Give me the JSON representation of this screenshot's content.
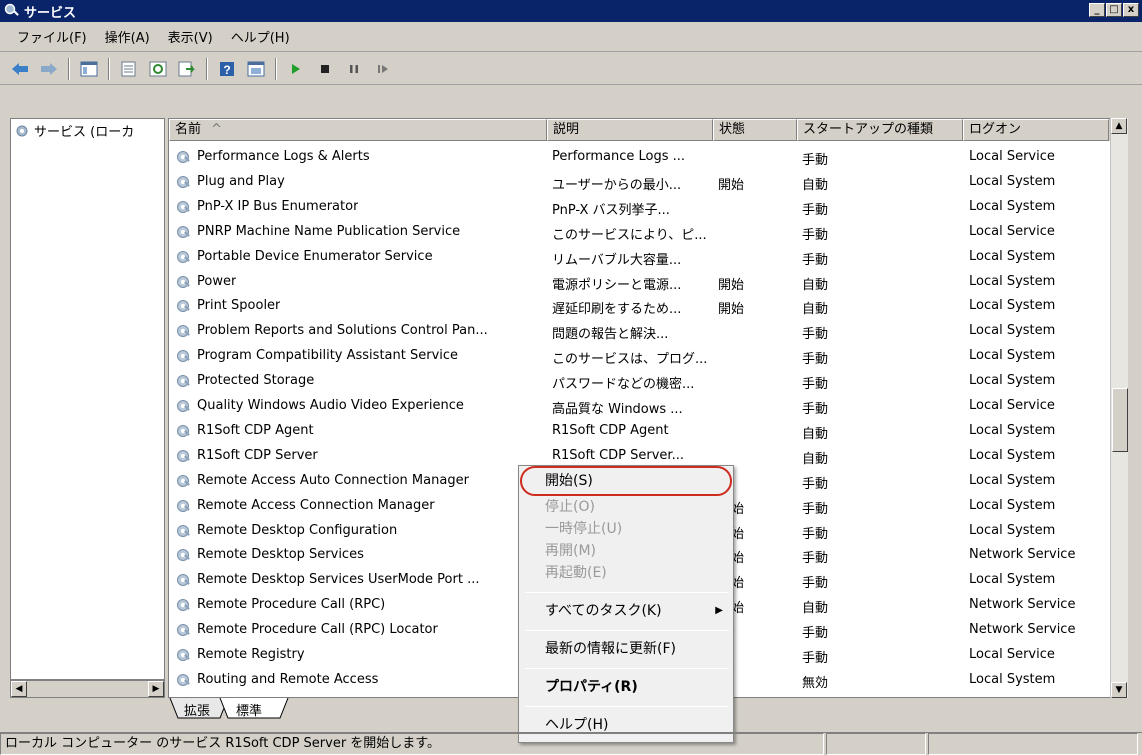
{
  "window": {
    "title": "サービス"
  },
  "menubar": [
    "ファイル(F)",
    "操作(A)",
    "表示(V)",
    "ヘルプ(H)"
  ],
  "toolbar": [
    "back-icon",
    "forward-icon",
    "up-icon",
    "show-hide-tree-icon",
    "properties-icon",
    "refresh-icon",
    "export-icon",
    "help-icon",
    "list-view-icon",
    "start-icon",
    "stop-icon",
    "pause-icon",
    "resume-icon"
  ],
  "tree": {
    "root_label": "サービス (ローカ"
  },
  "columns": {
    "name": "名前",
    "sort_indicator": "^",
    "description": "説明",
    "status": "状態",
    "startup": "スタートアップの種類",
    "logon": "ログオン"
  },
  "services": [
    {
      "name": "Performance Logs & Alerts",
      "desc": "Performance Logs ...",
      "status": "",
      "startup": "手動",
      "logon": "Local Service"
    },
    {
      "name": "Plug and Play",
      "desc": "ユーザーからの最小...",
      "status": "開始",
      "startup": "自動",
      "logon": "Local System"
    },
    {
      "name": "PnP-X IP Bus Enumerator",
      "desc": "PnP-X バス列挙子...",
      "status": "",
      "startup": "手動",
      "logon": "Local System"
    },
    {
      "name": "PNRP Machine Name Publication Service",
      "desc": "このサービスにより、ピ...",
      "status": "",
      "startup": "手動",
      "logon": "Local Service"
    },
    {
      "name": "Portable Device Enumerator Service",
      "desc": "リムーバブル大容量...",
      "status": "",
      "startup": "手動",
      "logon": "Local System"
    },
    {
      "name": "Power",
      "desc": "電源ポリシーと電源...",
      "status": "開始",
      "startup": "自動",
      "logon": "Local System"
    },
    {
      "name": "Print Spooler",
      "desc": "遅延印刷をするため...",
      "status": "開始",
      "startup": "自動",
      "logon": "Local System"
    },
    {
      "name": "Problem Reports and Solutions Control Pan...",
      "desc": "問題の報告と解決...",
      "status": "",
      "startup": "手動",
      "logon": "Local System"
    },
    {
      "name": "Program Compatibility Assistant Service",
      "desc": "このサービスは、プログ...",
      "status": "",
      "startup": "手動",
      "logon": "Local System"
    },
    {
      "name": "Protected Storage",
      "desc": "パスワードなどの機密...",
      "status": "",
      "startup": "手動",
      "logon": "Local System"
    },
    {
      "name": "Quality Windows Audio Video Experience",
      "desc": "高品質な Windows ...",
      "status": "",
      "startup": "手動",
      "logon": "Local Service"
    },
    {
      "name": "R1Soft CDP Agent",
      "desc": "R1Soft CDP Agent",
      "status": "",
      "startup": "自動",
      "logon": "Local System"
    },
    {
      "name": "R1Soft CDP Server",
      "desc": "R1Soft CDP Server...",
      "status": "",
      "startup": "自動",
      "logon": "Local System",
      "selected": true
    },
    {
      "name": "Remote Access Auto Connection Manager",
      "desc": "",
      "status": "",
      "startup": "手動",
      "logon": "Local System"
    },
    {
      "name": "Remote Access Connection Manager",
      "desc": "",
      "status": "開始",
      "startup": "手動",
      "logon": "Local System"
    },
    {
      "name": "Remote Desktop Configuration",
      "desc": "",
      "status": "開始",
      "startup": "手動",
      "logon": "Local System"
    },
    {
      "name": "Remote Desktop Services",
      "desc": "",
      "status": "開始",
      "startup": "手動",
      "logon": "Network Service"
    },
    {
      "name": "Remote Desktop Services UserMode Port ...",
      "desc": "",
      "status": "開始",
      "startup": "手動",
      "logon": "Local System"
    },
    {
      "name": "Remote Procedure Call (RPC)",
      "desc": "",
      "status": "開始",
      "startup": "自動",
      "logon": "Network Service"
    },
    {
      "name": "Remote Procedure Call (RPC) Locator",
      "desc": "",
      "status": "",
      "startup": "手動",
      "logon": "Network Service"
    },
    {
      "name": "Remote Registry",
      "desc": "",
      "status": "",
      "startup": "手動",
      "logon": "Local Service"
    },
    {
      "name": "Routing and Remote Access",
      "desc": "",
      "status": "",
      "startup": "無効",
      "logon": "Local System"
    }
  ],
  "tabs": [
    "拡張",
    "標準"
  ],
  "context_menu": {
    "start": "開始(S)",
    "stop": "停止(O)",
    "pause": "一時停止(U)",
    "resume": "再開(M)",
    "restart": "再起動(E)",
    "all_tasks": "すべてのタスク(K)",
    "refresh": "最新の情報に更新(F)",
    "properties": "プロパティ(R)",
    "help": "ヘルプ(H)"
  },
  "statusbar": {
    "text": "ローカル コンピューター のサービス R1Soft CDP Server を開始します。"
  },
  "colors": {
    "titlebar": "#0a246a",
    "selection": "#0a246a",
    "highlight_ring": "#cc2b1d",
    "chrome": "#d4d0c8"
  }
}
